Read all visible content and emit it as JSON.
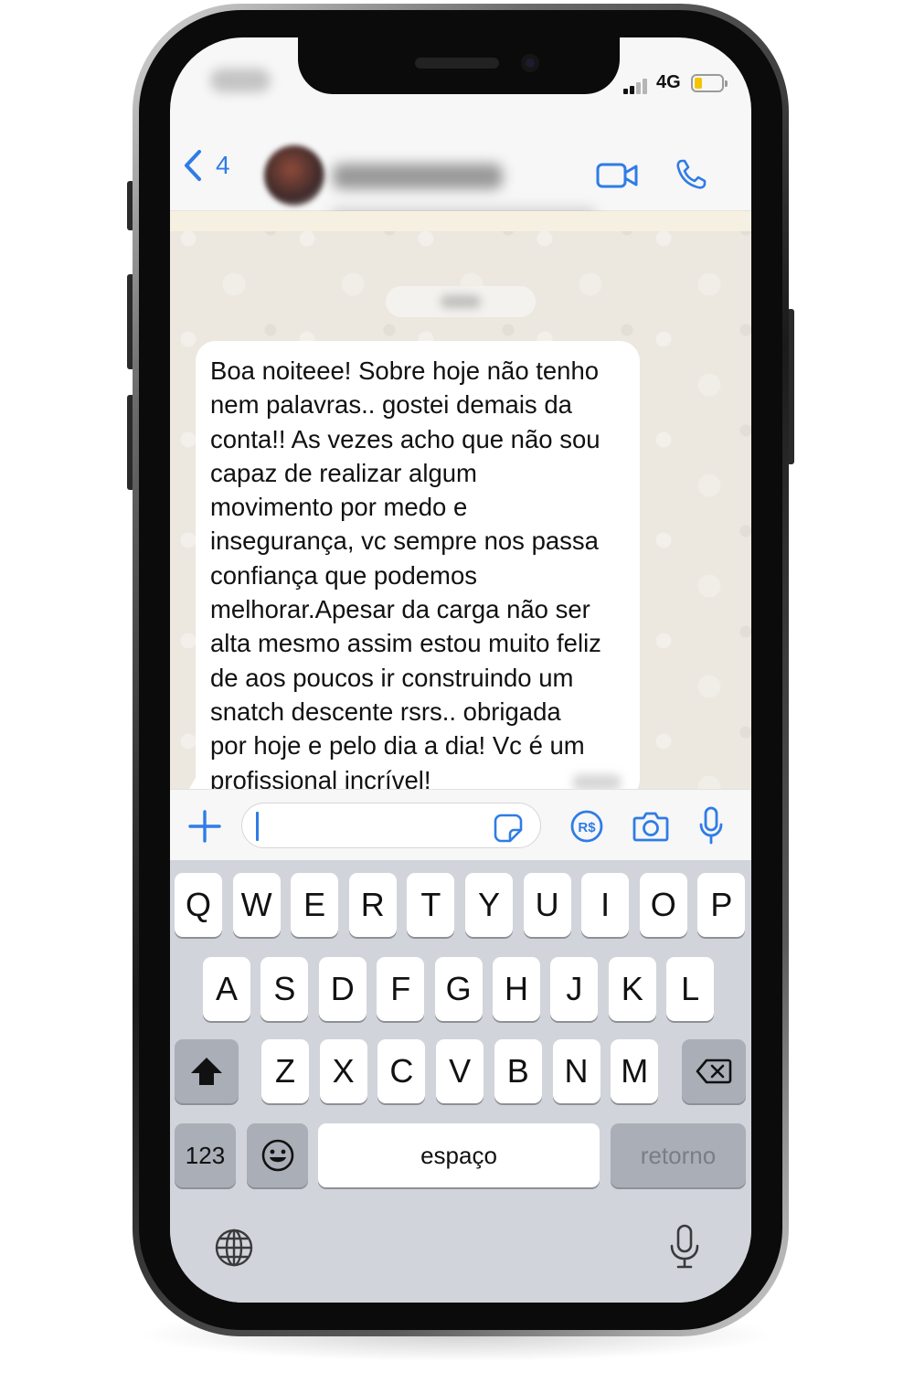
{
  "status_bar": {
    "time": "",
    "network": "4G",
    "battery_fill_fraction": 0.3,
    "battery_color": "#f5c400"
  },
  "header": {
    "back_count": "4",
    "contact_name": "",
    "contact_subtitle": "",
    "accent_color": "#2f7ce6"
  },
  "chat": {
    "date_chip": "",
    "message": {
      "text": "Boa noiteee! Sobre hoje não tenho\nnem palavras.. gostei demais da\nconta!! As vezes acho que não sou\ncapaz de realizar algum\nmovimento por medo e\ninsegurança, vc sempre nos passa\nconfiança que podemos\nmelhorar.Apesar da carga não ser\nalta mesmo assim estou muito feliz\nde aos poucos ir construindo um\nsnatch descente rsrs.. obrigada\npor hoje e pelo dia a dia! Vc é um\nprofissional incrível!",
      "time": ""
    }
  },
  "input_bar": {
    "value": "",
    "icons": [
      "plus-icon",
      "sticker-icon",
      "payment-icon",
      "camera-icon",
      "microphone-icon"
    ],
    "payment_label": "R$"
  },
  "keyboard": {
    "row1": [
      "Q",
      "W",
      "E",
      "R",
      "T",
      "Y",
      "U",
      "I",
      "O",
      "P"
    ],
    "row2": [
      "A",
      "S",
      "D",
      "F",
      "G",
      "H",
      "J",
      "K",
      "L"
    ],
    "row3": [
      "Z",
      "X",
      "C",
      "V",
      "B",
      "N",
      "M"
    ],
    "numbers_label": "123",
    "space_label": "espaço",
    "return_label": "retorno",
    "icons": [
      "shift-icon",
      "delete-icon",
      "emoji-icon",
      "globe-icon",
      "dictation-icon"
    ]
  }
}
